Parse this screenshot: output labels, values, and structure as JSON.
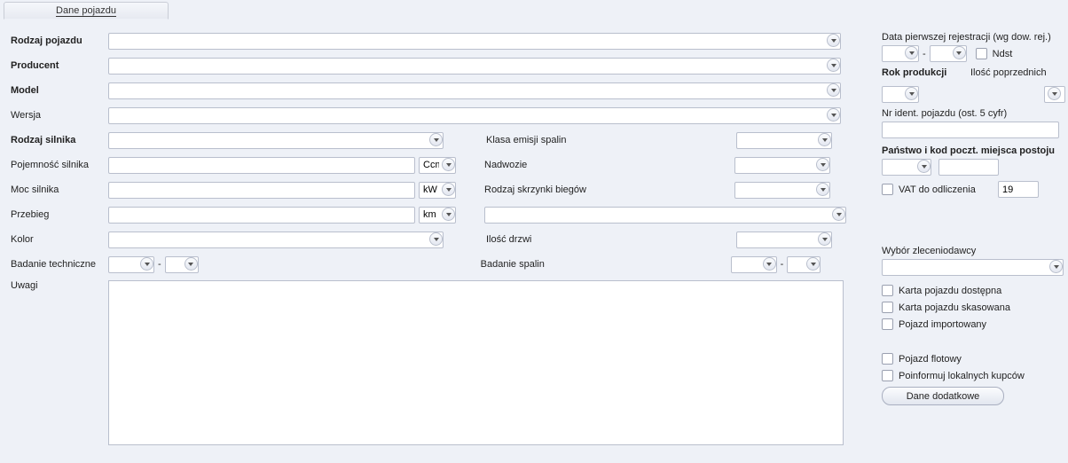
{
  "tab": {
    "label": "Dane pojazdu"
  },
  "left": {
    "vehicleType": "Rodzaj pojazdu",
    "manufacturer": "Producent",
    "model": "Model",
    "version": "Wersja",
    "engineType": "Rodzaj silnika",
    "emissionClass": "Klasa emisji spalin",
    "displacement": "Pojemność silnika",
    "displacementUnit": "Ccm",
    "body": "Nadwozie",
    "power": "Moc silnika",
    "powerUnit": "kW",
    "gearbox": "Rodzaj skrzynki biegów",
    "mileage": "Przebieg",
    "mileageUnit": "km",
    "color": "Kolor",
    "doors": "Ilość drzwi",
    "inspection": "Badanie techniczne",
    "emissionTest": "Badanie spalin",
    "notes": "Uwagi"
  },
  "right": {
    "firstReg": "Data pierwszej rejestracji (wg dow. rej.)",
    "ndst": "Ndst",
    "prodYear": "Rok produkcji",
    "prevOwners": "Ilość poprzednich",
    "vin": "Nr ident. pojazdu (ost. 5 cyfr)",
    "countryPost": "Państwo i kod poczt. miejsca postoju",
    "vatDeduct": "VAT do odliczenia",
    "vatValue": "19",
    "clientSel": "Wybór zleceniodawcy",
    "cardAvail": "Karta pojazdu dostępna",
    "cardCancelled": "Karta pojazdu skasowana",
    "imported": "Pojazd importowany",
    "fleet": "Pojazd flotowy",
    "informBuyers": "Poinformuj lokalnych kupców",
    "extraData": "Dane dodatkowe"
  }
}
